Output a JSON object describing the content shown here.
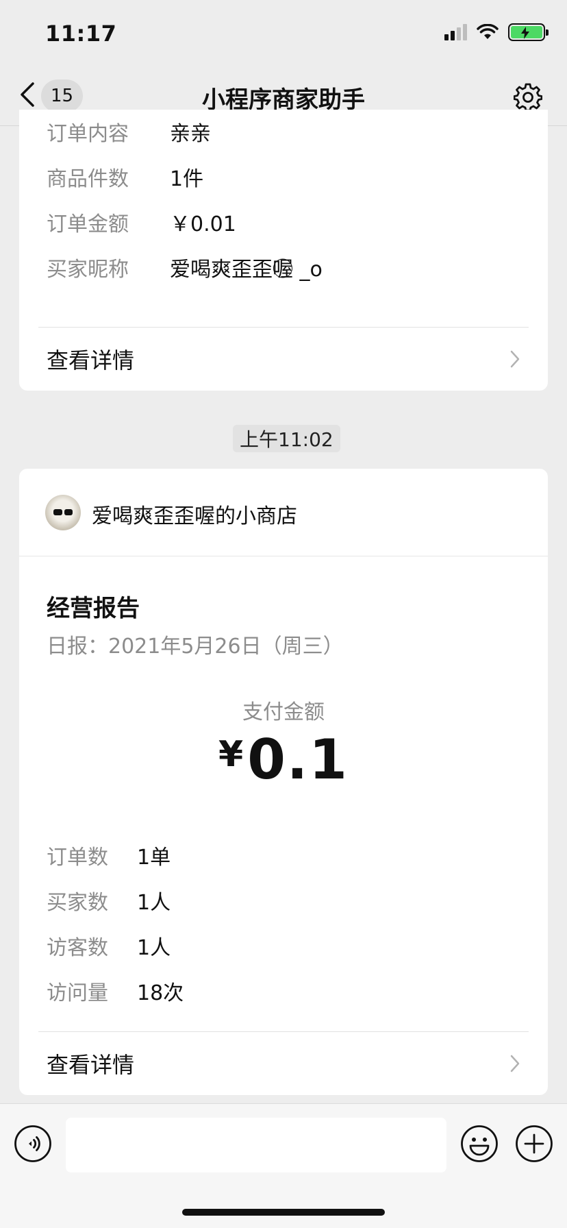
{
  "status_bar": {
    "time": "11:17",
    "icons": [
      "signal-icon",
      "wifi-icon",
      "battery-charging-icon"
    ]
  },
  "nav": {
    "unread_count": "15",
    "title": "小程序商家助手",
    "icons": [
      "back-chevron-icon",
      "gear-icon"
    ]
  },
  "order_card": {
    "rows": [
      {
        "label": "订单内容",
        "value": "亲亲"
      },
      {
        "label": "商品件数",
        "value": "1件"
      },
      {
        "label": "订单金额",
        "value": "￥0.01"
      },
      {
        "label": "买家昵称",
        "value": "爱喝爽歪歪喔⃝ _o"
      }
    ],
    "detail_label": "查看详情"
  },
  "timestamp": "上午11:02",
  "report_card": {
    "shop_name": "爱喝爽歪歪喔的小商店",
    "title": "经营报告",
    "date": "日报：2021年5月26日（周三）",
    "pay_label": "支付金额",
    "pay_currency": "¥",
    "pay_amount": "0.1",
    "stats": [
      {
        "label": "订单数",
        "value": "1单"
      },
      {
        "label": "买家数",
        "value": "1人"
      },
      {
        "label": "访客数",
        "value": "1人"
      },
      {
        "label": "访问量",
        "value": "18次"
      }
    ],
    "detail_label": "查看详情"
  },
  "input_bar": {
    "placeholder": "",
    "icons": [
      "voice-icon",
      "emoji-icon",
      "plus-icon"
    ]
  },
  "colors": {
    "background": "#ededed",
    "card": "#ffffff",
    "label_gray": "#8c8c8c",
    "battery_green": "#4cd964"
  }
}
